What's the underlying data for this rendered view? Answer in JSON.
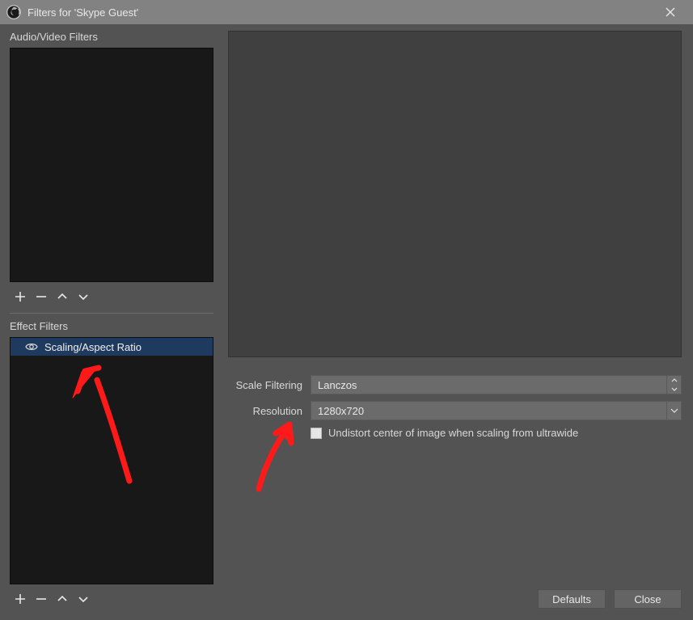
{
  "window": {
    "title": "Filters for 'Skype Guest'"
  },
  "left": {
    "av_label": "Audio/Video Filters",
    "eff_label": "Effect Filters",
    "filters": [
      {
        "name": "Scaling/Aspect Ratio"
      }
    ]
  },
  "props": {
    "scale_filtering_label": "Scale Filtering",
    "scale_filtering_value": "Lanczos",
    "resolution_label": "Resolution",
    "resolution_value": "1280x720",
    "undistort_label": "Undistort center of image when scaling from ultrawide"
  },
  "buttons": {
    "defaults": "Defaults",
    "close": "Close"
  }
}
